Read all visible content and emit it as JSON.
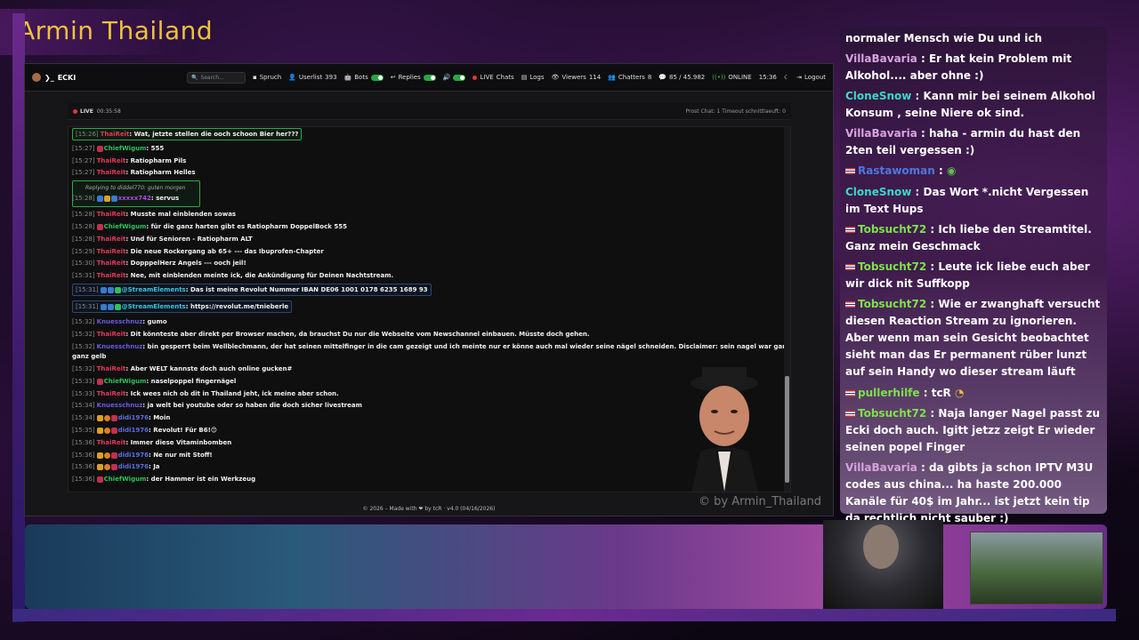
{
  "overlay": {
    "title": "Armin Thailand",
    "watermark": "© by Armin_Thailand"
  },
  "topbar": {
    "brand": "ECKI",
    "search_placeholder": "Search...",
    "spruch": "Spruch",
    "userlist": "Userlist",
    "userlist_count": "393",
    "bots": "Bots",
    "replies": "Replies",
    "live": "LIVE",
    "chats": "Chats",
    "logs": "Logs",
    "viewers": "Viewers",
    "viewers_count": "114",
    "chatters": "Chatters",
    "chatters_count": "8",
    "messages": "85 / 45.982",
    "online": "ONLINE",
    "time": "15:36",
    "logout": "Logout"
  },
  "statusbar": {
    "live": "LIVE",
    "duration": "00:35:58",
    "right": "Prost Chat: 1   Timeout schnittlaeuft: 0"
  },
  "messages": [
    {
      "ts": "[15:26]",
      "user": "ThaiReit",
      "text": ": Wat, jetzte stellen die ooch schoon Bier her???"
    },
    {
      "ts": "[15:27]",
      "user": "ChiefWigum",
      "text": ": 555"
    },
    {
      "ts": "[15:27]",
      "user": "ThaiReit",
      "text": ": Ratiopharm Pils"
    },
    {
      "ts": "[15:27]",
      "user": "ThaiReit",
      "text": ": Ratiopharm Helles"
    },
    {
      "reply": "Replying to diddel770: guten morgen"
    },
    {
      "ts": "[15:28]",
      "user": "xxxxx742",
      "text": ": servus"
    },
    {
      "ts": "[15:28]",
      "user": "ThaiReit",
      "text": ": Musste mal einblenden sowas"
    },
    {
      "ts": "[15:28]",
      "user": "ChiefWigum",
      "text": ": für die ganz harten gibt es Ratiopharm DoppelBock 555"
    },
    {
      "ts": "[15:28]",
      "user": "ThaiReit",
      "text": ": Und für Senioren - Ratiopharm ALT"
    },
    {
      "ts": "[15:29]",
      "user": "ThaiReit",
      "text": ": Die neue Rockergang ab 65+ --- das Ibuprofen-Chapter"
    },
    {
      "ts": "[15:30]",
      "user": "ThaiReit",
      "text": ": DopppelHerz Angels --- ooch jeil!"
    },
    {
      "ts": "[15:31]",
      "user": "ThaiReit",
      "text": ": Nee, mit einblenden meinte ick, die Ankündigung für Deinen Nachtstream."
    },
    {
      "ts": "[15:31]",
      "user": "@StreamElements",
      "text": ": Das ist meine Revolut Nummer IBAN DE06 1001 0178 6235 1689 93"
    },
    {
      "ts": "[15:31]",
      "user": "@StreamElements",
      "text": ": https://revolut.me/tnieberle"
    },
    {
      "ts": "[15:32]",
      "user": "Knuesschnuz",
      "text": ": gumo"
    },
    {
      "ts": "[15:32]",
      "user": "ThaiReit",
      "text": ": Dit könnteste aber direkt per Browser machen, da brauchst Du nur die Webseite vom Newschannel einbauen. Müsste doch gehen."
    },
    {
      "ts": "[15:32]",
      "user": "Knuesschnuz",
      "text": ": bin gesperrt beim Wellblechmann, der hat seinen mittelfinger in die cam gezeigt und ich meinte nur er könne auch mal wieder seine nägel schneiden. Disclaimer: sein nagel war ganz lang und auch"
    },
    {
      "ts": "",
      "user": "",
      "text": "ganz gelb"
    },
    {
      "ts": "[15:32]",
      "user": "ThaiReit",
      "text": ": Aber WELT kannste doch auch online gucken#"
    },
    {
      "ts": "[15:33]",
      "user": "ChiefWigum",
      "text": ": naselpoppel fingernägel"
    },
    {
      "ts": "[15:33]",
      "user": "ThaiReit",
      "text": ": Ick wees nich ob dit in Thailand jeht, ick meine aber schon."
    },
    {
      "ts": "[15:34]",
      "user": "Knuesschnuz",
      "text": ": ja welt bei youtube oder so haben die doch sicher livestream"
    },
    {
      "ts": "[15:34]",
      "user": "didi1976",
      "text": ": Moin"
    },
    {
      "ts": "[15:35]",
      "user": "didi1976",
      "text": ": Revolut! Für B6!😊"
    },
    {
      "ts": "[15:36]",
      "user": "ThaiReit",
      "text": ": Immer diese Vitaminbomben"
    },
    {
      "ts": "[15:36]",
      "user": "didi1976",
      "text": ": Ne nur mit Stoff!"
    },
    {
      "ts": "[15:36]",
      "user": "didi1976",
      "text": ": Ja"
    },
    {
      "ts": "[15:36]",
      "user": "ChiefWigum",
      "text": ": der Hammer ist ein Werkzeug"
    }
  ],
  "footer": "© 2026 – Made with ❤ by tcR · v4.0 (04/16/2026)",
  "right_chat": [
    {
      "user": "",
      "text": "normaler Mensch wie Du und ich"
    },
    {
      "user": "VillaBavaria",
      "text": " : Er hat kein Problem mit Alkohol.... aber ohne :)"
    },
    {
      "user": "CloneSnow",
      "text": " : Kann mir bei seinem Alkohol Konsum , seine Niere ok sind."
    },
    {
      "user": "VillaBavaria",
      "text": " : haha - armin du hast den 2ten teil vergessen :)"
    },
    {
      "user": "Rastawoman",
      "text": " : "
    },
    {
      "user": "CloneSnow",
      "text": " : Das Wort *.nicht Vergessen im Text Hups"
    },
    {
      "user": "Tobsucht72",
      "text": " : Ich liebe den Streamtitel. Ganz mein Geschmack"
    },
    {
      "user": "Tobsucht72",
      "text": " : Leute ick liebe euch aber wir dick nit Suffkopp"
    },
    {
      "user": "Tobsucht72",
      "text": " : Wie er zwanghaft versucht diesen Reaction Stream zu ignorieren. Aber wenn man sein Gesicht beobachtet sieht man das Er permanent rüber lunzt auf sein Handy wo dieser stream läuft"
    },
    {
      "user": "pullerhilfe",
      "text": " : tcR"
    },
    {
      "user": "Tobsucht72",
      "text": " : Naja langer Nagel passt zu Ecki doch auch. Igitt jetzz zeigt Er wieder seinen popel Finger"
    },
    {
      "user": "VillaBavaria",
      "text": " : da gibts ja schon IPTV M3U codes aus china... ha haste 200.000 Kanäle für 40$ im Jahr... ist jetzt kein tip da rechtlich nicht sauber :)"
    }
  ]
}
